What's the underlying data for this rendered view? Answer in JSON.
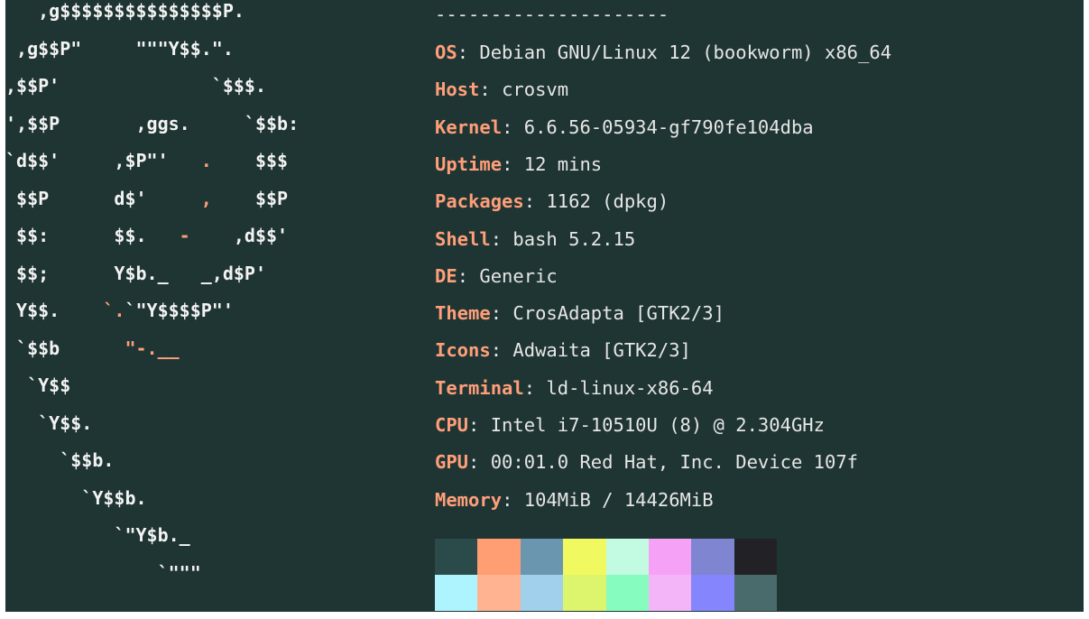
{
  "logo_lines": [
    {
      "parts": [
        {
          "t": "   ,g$$$$$$$$$$$$$$$P.",
          "c": ""
        }
      ]
    },
    {
      "parts": [
        {
          "t": " ,g$$P\"     \"\"\"Y$$.\".",
          "c": ""
        }
      ]
    },
    {
      "parts": [
        {
          "t": ",$$P'              `$$$.",
          "c": ""
        }
      ]
    },
    {
      "parts": [
        {
          "t": "',$$P       ,ggs.     `$$b:",
          "c": ""
        }
      ]
    },
    {
      "parts": [
        {
          "t": "`d$$'     ,$P\"'   ",
          "c": ""
        },
        {
          "t": ".",
          "c": "acc"
        },
        {
          "t": "    $$$",
          "c": ""
        }
      ]
    },
    {
      "parts": [
        {
          "t": " $$P      d$'     ",
          "c": ""
        },
        {
          "t": ",",
          "c": "acc"
        },
        {
          "t": "    $$P",
          "c": ""
        }
      ]
    },
    {
      "parts": [
        {
          "t": " $$:      $$.   ",
          "c": ""
        },
        {
          "t": "-",
          "c": "acc"
        },
        {
          "t": "    ,d$$'",
          "c": ""
        }
      ]
    },
    {
      "parts": [
        {
          "t": " $$;      Y$b._   _,d$P'",
          "c": ""
        }
      ]
    },
    {
      "parts": [
        {
          "t": " Y$$.    ",
          "c": ""
        },
        {
          "t": "`.",
          "c": "acc"
        },
        {
          "t": "`\"Y$$$$P\"'",
          "c": ""
        }
      ]
    },
    {
      "parts": [
        {
          "t": " `$$b      ",
          "c": ""
        },
        {
          "t": "\"-.__",
          "c": "acc"
        }
      ]
    },
    {
      "parts": [
        {
          "t": "  `Y$$",
          "c": ""
        }
      ]
    },
    {
      "parts": [
        {
          "t": "   `Y$$.",
          "c": ""
        }
      ]
    },
    {
      "parts": [
        {
          "t": "     `$$b.",
          "c": ""
        }
      ]
    },
    {
      "parts": [
        {
          "t": "       `Y$$b.",
          "c": ""
        }
      ]
    },
    {
      "parts": [
        {
          "t": "          `\"Y$b._",
          "c": ""
        }
      ]
    },
    {
      "parts": [
        {
          "t": "              `\"\"\"",
          "c": ""
        }
      ]
    }
  ],
  "separator": "---------------------",
  "info": [
    {
      "key": "OS",
      "value": "Debian GNU/Linux 12 (bookworm) x86_64"
    },
    {
      "key": "Host",
      "value": "crosvm"
    },
    {
      "key": "Kernel",
      "value": "6.6.56-05934-gf790fe104dba"
    },
    {
      "key": "Uptime",
      "value": "12 mins"
    },
    {
      "key": "Packages",
      "value": "1162 (dpkg)"
    },
    {
      "key": "Shell",
      "value": "bash 5.2.15"
    },
    {
      "key": "DE",
      "value": "Generic"
    },
    {
      "key": "Theme",
      "value": "CrosAdapta [GTK2/3]"
    },
    {
      "key": "Icons",
      "value": "Adwaita [GTK2/3]"
    },
    {
      "key": "Terminal",
      "value": "ld-linux-x86-64"
    },
    {
      "key": "CPU",
      "value": "Intel i7-10510U (8) @ 2.304GHz"
    },
    {
      "key": "GPU",
      "value": "00:01.0 Red Hat, Inc. Device 107f"
    },
    {
      "key": "Memory",
      "value": "104MiB / 14426MiB"
    }
  ],
  "palette_top": [
    "#2b4a4a",
    "#ff9e72",
    "#6a96b0",
    "#f0fa60",
    "#c2fbe2",
    "#f5a1f5",
    "#7f85d0",
    "#222226"
  ],
  "palette_bottom": [
    "#aef4fe",
    "#ffb391",
    "#a1d0ec",
    "#dcf56c",
    "#86fdbf",
    "#f4b5f8",
    "#8585fe",
    "#4a6b6b"
  ],
  "colors": {
    "background": "#1f3533",
    "accent": "#ff9f7a",
    "text": "#e6e6e6"
  }
}
